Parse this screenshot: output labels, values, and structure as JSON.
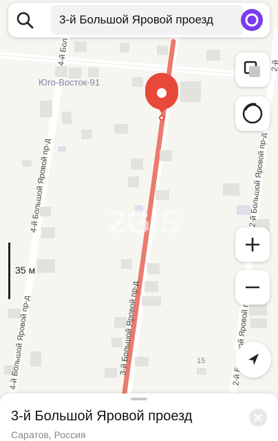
{
  "search": {
    "query": "3-й Большой Яровой проезд"
  },
  "map": {
    "district_label": "Юго-Восток-91",
    "street_labels": {
      "main": "3-й Большой Яровой пр-д",
      "left": "4-й Большой Яровой пр-д",
      "right": "2-й Большой Яровой пр-д",
      "top_left": "4-й Бол",
      "top_right": "2-й"
    },
    "house_number": "15",
    "watermark": "2GIS"
  },
  "scale": {
    "label": "35 м"
  },
  "place": {
    "title": "3-й Большой Яровой проезд",
    "subtitle": "Саратов, Россия"
  },
  "colors": {
    "route": "#ea7b6e",
    "pin": "#e8493a",
    "alice": "#7a3cf0",
    "building": "#e3e2dc"
  },
  "icons": {
    "search": "search-icon",
    "alice": "alice-voice-icon",
    "layers": "layers-icon",
    "compass": "compass-icon",
    "zoom_in": "zoom-in-icon",
    "zoom_out": "zoom-out-icon",
    "location": "my-location-icon",
    "close": "close-icon",
    "pin": "location-pin-icon"
  }
}
